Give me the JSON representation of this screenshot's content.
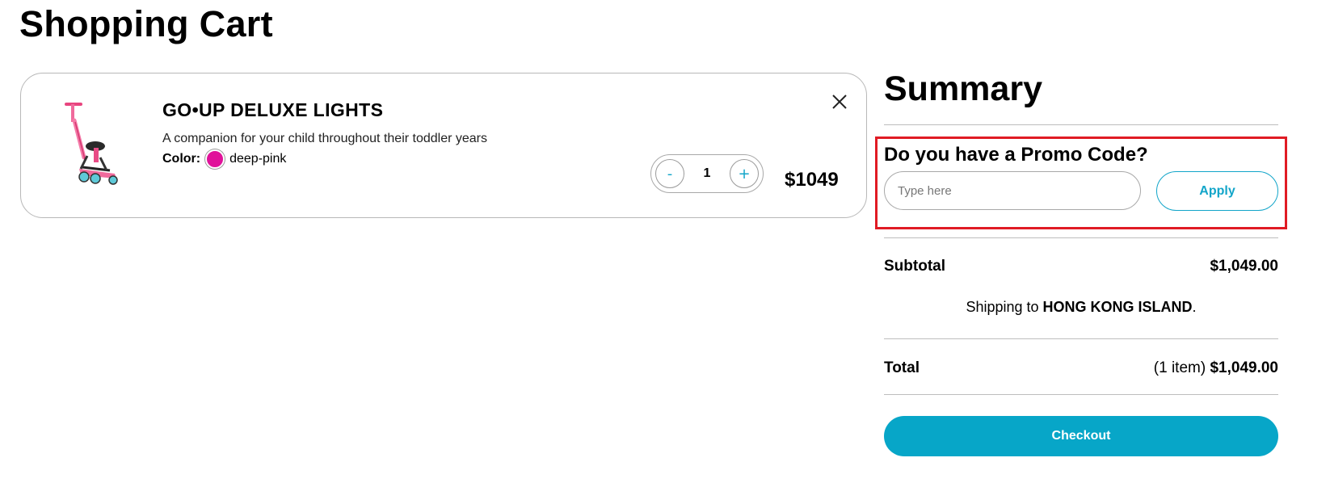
{
  "page_title": "Shopping Cart",
  "cart": {
    "items": [
      {
        "name": "GO•UP DELUXE LIGHTS",
        "description": "A companion for your child throughout their toddler years",
        "color_label": "Color:",
        "color_name": "deep-pink",
        "color_hex": "#e0129a",
        "quantity": "1",
        "decrement_label": "-",
        "increment_label": "+",
        "price": "$1049",
        "remove_icon": "close-icon",
        "image_icon": "scooter-image"
      }
    ]
  },
  "summary": {
    "title": "Summary",
    "promo": {
      "heading": "Do you have a Promo Code?",
      "placeholder": "Type here",
      "value": "",
      "apply_label": "Apply"
    },
    "subtotal_label": "Subtotal",
    "subtotal_value": "$1,049.00",
    "shipping_prefix": "Shipping to",
    "shipping_region": "HONG KONG ISLAND",
    "shipping_suffix": ".",
    "total_label": "Total",
    "total_count": "(1 item)",
    "total_value": "$1,049.00",
    "checkout_label": "Checkout"
  },
  "colors": {
    "accent": "#07a6c8",
    "highlight_border": "#e01b24",
    "swatch": "#e0129a"
  }
}
